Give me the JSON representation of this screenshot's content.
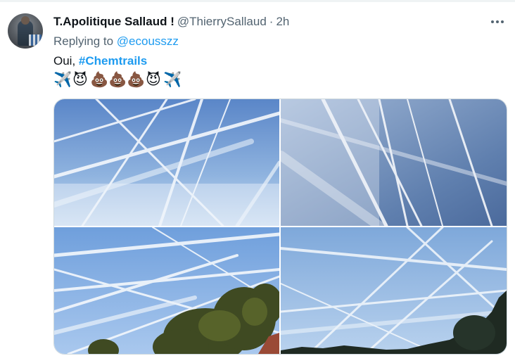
{
  "tweet": {
    "display_name": "T.Apolitique Sallaud !",
    "handle": "@ThierrySallaud",
    "separator": "·",
    "time": "2h",
    "replying_prefix": "Replying to ",
    "replying_to": "@ecousszz",
    "text_prefix": "Oui, ",
    "hashtag": "#Chemtrails",
    "emojis": [
      "✈️",
      "😈",
      "💩",
      "💩",
      "💩",
      "😈",
      "✈️"
    ],
    "emoji_names": [
      "airplane-icon",
      "smiling-devil-icon",
      "poop-icon",
      "poop-icon",
      "poop-icon",
      "smiling-devil-icon",
      "airplane-icon"
    ]
  },
  "media": {
    "photos": [
      {
        "name": "photo-1",
        "description_icon": "sky-contrails-photo"
      },
      {
        "name": "photo-2",
        "description_icon": "sky-contrails-photo"
      },
      {
        "name": "photo-3",
        "description_icon": "sky-contrails-trees-photo"
      },
      {
        "name": "photo-4",
        "description_icon": "sky-contrails-treeline-photo"
      }
    ]
  },
  "colors": {
    "link": "#1d9bf0",
    "secondary_text": "#536471",
    "primary_text": "#0f1419",
    "border": "#cfd9de"
  }
}
